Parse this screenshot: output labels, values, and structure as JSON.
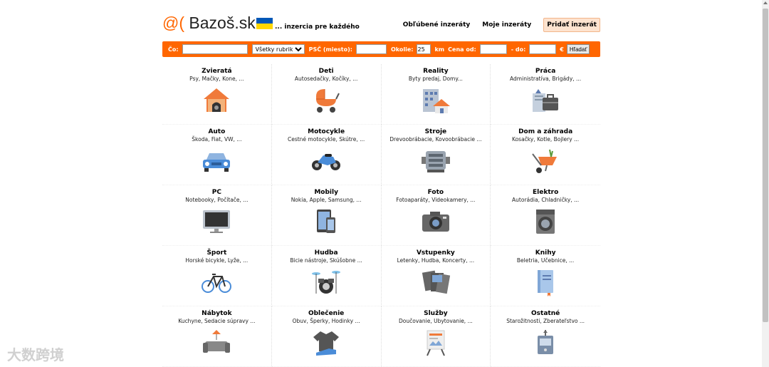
{
  "header": {
    "logo_at": "@(",
    "logo_name": "Bazoš.sk",
    "tagline": "... inzercia pre každého",
    "links": [
      "Obľúbené inzeráty",
      "Moje inzeráty"
    ],
    "add_button": "Pridať inzerát"
  },
  "search": {
    "co_label": "Čo:",
    "rubric_selected": "Všetky rubriky",
    "psc_label": "PSČ (miesto):",
    "okolie_label": "Okolie:",
    "okolie_value": "25",
    "km_label": "km",
    "cena_label": "Cena od:",
    "do_label": "- do:",
    "currency": "€",
    "submit": "Hľadať"
  },
  "categories": [
    {
      "title": "Zvieratá",
      "sub": "Psy, Mačky, Kone, ...",
      "icon": "doghouse-icon"
    },
    {
      "title": "Deti",
      "sub": "Autosedačky, Kočíky, ...",
      "icon": "stroller-icon"
    },
    {
      "title": "Reality",
      "sub": "Byty predaj, Domy...",
      "icon": "building-icon"
    },
    {
      "title": "Práca",
      "sub": "Administratíva, Brigády, ...",
      "icon": "briefcase-icon"
    },
    {
      "title": "Auto",
      "sub": "Škoda, Fiat, VW, ...",
      "icon": "car-icon"
    },
    {
      "title": "Motocykle",
      "sub": "Cestné motocykle, Skútre, ...",
      "icon": "motorcycle-icon"
    },
    {
      "title": "Stroje",
      "sub": "Drevoobrábacie, Kovoobrábacie ...",
      "icon": "machine-icon"
    },
    {
      "title": "Dom a záhrada",
      "sub": "Kosačky, Kotle, Bojlery ...",
      "icon": "wheelbarrow-icon"
    },
    {
      "title": "PC",
      "sub": "Notebooky, Počítače, ...",
      "icon": "monitor-icon"
    },
    {
      "title": "Mobily",
      "sub": "Nokia, Apple, Samsung, ...",
      "icon": "phone-icon"
    },
    {
      "title": "Foto",
      "sub": "Fotoaparáty, Videokamery, ...",
      "icon": "camera-icon"
    },
    {
      "title": "Elektro",
      "sub": "Autorádia, Chladničky, ...",
      "icon": "washing-machine-icon"
    },
    {
      "title": "Šport",
      "sub": "Horské bicykle, Lyže, ...",
      "icon": "bicycle-icon"
    },
    {
      "title": "Hudba",
      "sub": "Bicie nástroje, Skúšobne ...",
      "icon": "drums-icon"
    },
    {
      "title": "Vstupenky",
      "sub": "Letenky, Hudba, Koncerty, ...",
      "icon": "tickets-icon"
    },
    {
      "title": "Knihy",
      "sub": "Beletria, Učebnice, ...",
      "icon": "book-icon"
    },
    {
      "title": "Nábytok",
      "sub": "Kuchyne, Sedacie súpravy ...",
      "icon": "sofa-icon"
    },
    {
      "title": "Oblečenie",
      "sub": "Obuv, Šperky, Hodinky ...",
      "icon": "tshirt-icon"
    },
    {
      "title": "Služby",
      "sub": "Doučovanie, Ubytovanie, ...",
      "icon": "easel-icon"
    },
    {
      "title": "Ostatné",
      "sub": "Starožitnosti, Zberateľstvo ...",
      "icon": "misc-box-icon"
    }
  ],
  "watermark": "大数跨境",
  "colors": {
    "accent": "#ff6600",
    "add_button_bg": "#fde3cf",
    "flag_blue": "#0057b7",
    "flag_yellow": "#ffd700"
  }
}
